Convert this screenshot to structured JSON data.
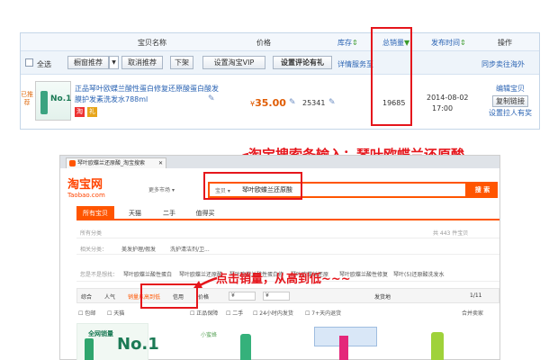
{
  "top_panel": {
    "header": {
      "item_name": "宝贝名称",
      "price": "价格",
      "stock": "库存",
      "sales": "总销量",
      "publish_time": "发布时间",
      "actions": "操作"
    },
    "toolbar": {
      "select_all": "全选",
      "showcase_recommend": "橱窗推荐",
      "cancel_recommend": "取消推荐",
      "delist": "下架",
      "set_vip": "设置淘宝VIP",
      "set_review_gift": "设置评论有礼",
      "service_detail": "详情服务至",
      "sync_overseas": "同步卖往海外"
    },
    "row": {
      "recommended_label": "已推荐",
      "title": "正品琴叶欧蝶兰酸性蛋白修复还原酸蛋白酸发膜护发素洗发水788ml",
      "price_symbol": "¥",
      "price": "35.00",
      "stock": "25341",
      "sales": "19685",
      "date": "2014-08-02",
      "time": "17:00",
      "edit_item": "编辑宝贝",
      "copy_link": "复制链接",
      "set_promotion": "设置拉人有奖"
    }
  },
  "bottom_panel": {
    "tab_title": "琴叶欧蝶兰还原酸_淘宝搜索",
    "logo": "淘宝网",
    "logo_sub": "Taobao.com",
    "market_selector": "更多市场",
    "search_scope": "宝贝",
    "search_query": "琴叶欧蝶兰还原酸",
    "search_button": "搜 索",
    "nav_tabs": [
      "所有宝贝",
      "天猫",
      "二手",
      "值得买"
    ],
    "result_count": "共 443 件宝贝",
    "related_category_label": "所有分类",
    "related_label": "相关分类：",
    "related_items": [
      "美发护理/假发",
      "洗护清洁剂/卫..."
    ],
    "you_want_label": "您是不是想找：",
    "you_want_items": [
      "琴叶欧蝶兰酸性蛋白",
      "琴叶欧蝶兰还原酸",
      "琴叶欧蝶兰酸性蛋白修",
      "琴叶欧蝶兰还原",
      "琴叶欧蝶兰酸性修复",
      "琴叶(5)还原酸洗发水"
    ],
    "sort_options": [
      "综合",
      "人气",
      "销量从高到低",
      "信用",
      "价格"
    ],
    "price_from": "¥",
    "price_to": "¥",
    "ship_from": "发货地",
    "page_indicator": "1/11",
    "filter_options": [
      "包邮",
      "天猫",
      "正品保障",
      "二手",
      "24小时内发货",
      "7+天内退货"
    ],
    "compare_label": "合并卖家",
    "product_caption": "全网销量",
    "product_badge": "No.1",
    "product2_label": "小蜜蜂"
  },
  "annotations": {
    "search_instruction": "淘宝搜索条输入：琴叶欧蝶兰还原酸",
    "sort_instruction": "点击销量，从高到低~~~"
  },
  "colors": {
    "annotation_red": "#e5161c",
    "taobao_orange": "#ff5500",
    "link_blue": "#2a63b3",
    "price_orange": "#e05d05"
  }
}
